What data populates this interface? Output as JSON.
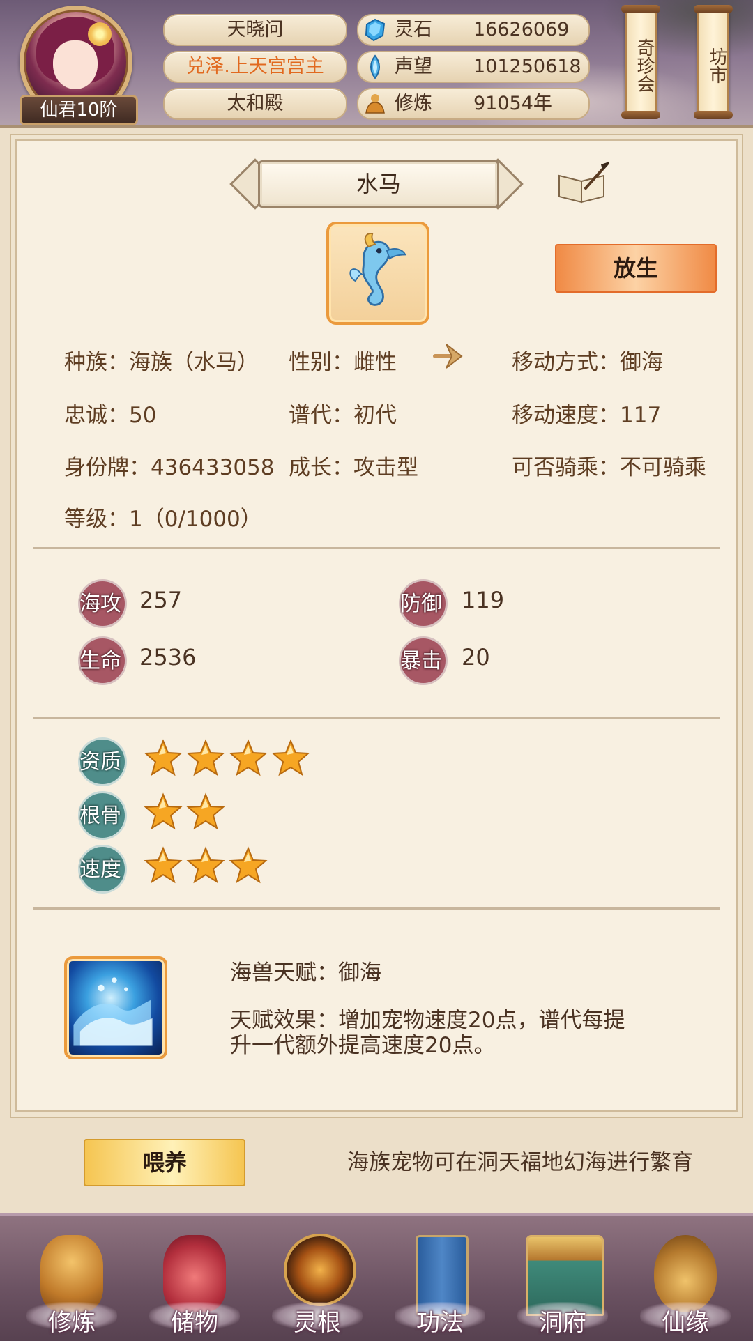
{
  "header": {
    "rank_badge": "仙君10阶",
    "player_name": "天晓问",
    "player_title": "兑泽.上天宫宫主",
    "location": "太和殿",
    "resources": [
      {
        "label": "灵石",
        "value": "16626069",
        "icon": "spirit-stone-icon"
      },
      {
        "label": "声望",
        "value": "101250618",
        "icon": "prestige-crystal-icon"
      },
      {
        "label": "修炼",
        "value": "91054年",
        "icon": "cultivation-monk-icon"
      }
    ],
    "side_buttons": [
      "奇珍会",
      "坊市"
    ]
  },
  "pet": {
    "name": "水马",
    "release_label": "放生",
    "attributes": {
      "race": "种族：海族（水马）",
      "gender": "性别：雌性",
      "move_mode": "移动方式：御海",
      "loyalty": "忠诚：50",
      "generation": "谱代：初代",
      "move_speed": "移动速度：117",
      "id_tag": "身份牌：436433058",
      "growth": "成长：攻击型",
      "rideable": "可否骑乘：不可骑乘",
      "level": "等级：1（0/1000）"
    },
    "stats": [
      {
        "label": "海攻",
        "value": "257"
      },
      {
        "label": "防御",
        "value": "119"
      },
      {
        "label": "生命",
        "value": "2536"
      },
      {
        "label": "暴击",
        "value": "20"
      }
    ],
    "qualities": [
      {
        "label": "资质",
        "stars": 4
      },
      {
        "label": "根骨",
        "stars": 2
      },
      {
        "label": "速度",
        "stars": 3
      }
    ],
    "talent": {
      "name": "海兽天赋：御海",
      "effect_line1": "天赋效果：增加宠物速度20点，谱代每提",
      "effect_line2": "升一代额外提高速度20点。"
    },
    "feed_label": "喂养",
    "hint": "海族宠物可在洞天福地幻海进行繁育"
  },
  "bottom_nav": [
    {
      "label": "修炼",
      "icon": "cultivation-icon"
    },
    {
      "label": "储物",
      "icon": "storage-bag-icon"
    },
    {
      "label": "灵根",
      "icon": "spirit-root-icon"
    },
    {
      "label": "功法",
      "icon": "technique-book-icon"
    },
    {
      "label": "洞府",
      "icon": "cave-mansion-icon"
    },
    {
      "label": "仙缘",
      "icon": "immortal-fate-icon"
    }
  ],
  "colors": {
    "accent_orange": "#eb9a3c",
    "title_orange": "#e1691f",
    "stat_red": "#a75764",
    "quality_teal": "#4f8d8a",
    "star_gold": "#f6a623"
  }
}
